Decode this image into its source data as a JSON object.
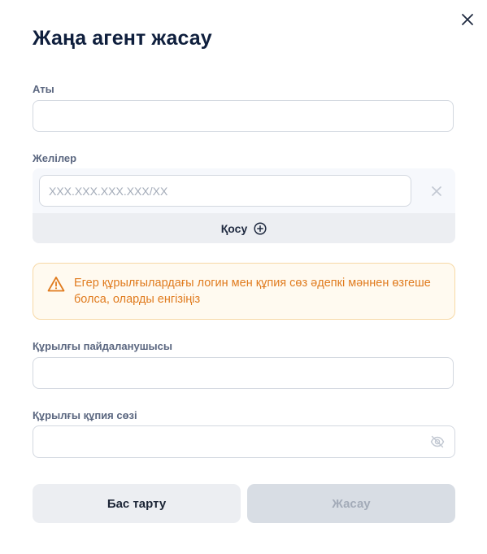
{
  "dialog": {
    "title": "Жаңа агент жасау"
  },
  "fields": {
    "name": {
      "label": "Аты",
      "value": "",
      "placeholder": ""
    },
    "networks": {
      "label": "Желілер",
      "items": [
        {
          "value": "",
          "placeholder": "XXX.XXX.XXX.XXX/XX"
        }
      ],
      "add_label": "Қосу"
    },
    "device_user": {
      "label": "Құрылғы пайдаланушысы",
      "value": "",
      "placeholder": ""
    },
    "device_password": {
      "label": "Құрылғы құпия сөзі",
      "value": "",
      "placeholder": ""
    }
  },
  "alert": {
    "text": "Егер құрылғылардағы логин мен құпия сөз әдепкі мәннен өзгеше болса, оларды енгізіңіз",
    "color": "#e07b1e"
  },
  "actions": {
    "cancel_label": "Бас тарту",
    "create_label": "Жасау"
  },
  "icons": {
    "close": "close-icon",
    "remove": "close-icon",
    "add": "plus-circle-icon",
    "warning": "warning-icon",
    "password_toggle": "eye-off-icon"
  },
  "colors": {
    "title": "#0f1f3d",
    "create_disabled_bg": "#d8dde4",
    "cancel_bg": "#eceef2"
  }
}
